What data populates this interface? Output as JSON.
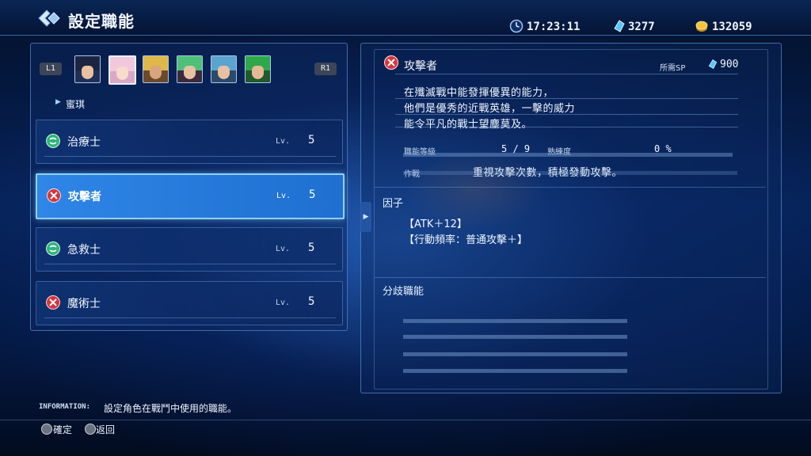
{
  "header": {
    "title": "設定職能",
    "time": "17:23:11",
    "crystals": "3277",
    "gold": "132059"
  },
  "left": {
    "l1": "L1",
    "r1": "R1",
    "portraits": [
      "character-portrait-1",
      "character-portrait-2",
      "character-portrait-3",
      "character-portrait-4",
      "character-portrait-5",
      "character-portrait-6"
    ],
    "character_name": "蜜琪",
    "jobs": [
      {
        "name": "治療士",
        "lv_label": "Lv.",
        "lv": "5",
        "icon": "heal-icon"
      },
      {
        "name": "攻擊者",
        "lv_label": "Lv.",
        "lv": "5",
        "icon": "attack-icon"
      },
      {
        "name": "急救士",
        "lv_label": "Lv.",
        "lv": "5",
        "icon": "heal-icon"
      },
      {
        "name": "魔術士",
        "lv_label": "Lv.",
        "lv": "5",
        "icon": "attack-icon"
      }
    ]
  },
  "detail": {
    "job_title": "攻擊者",
    "sp_label": "所需SP",
    "sp_value": "900",
    "description": [
      "在殲滅戰中能發揮優異的能力，",
      "他們是優秀的近戰英雄，一擊的威力",
      "能令平凡的戰士望塵莫及。"
    ],
    "job_level_label": "職能等級",
    "job_level": "5 / 9",
    "proficiency_label": "熟練度",
    "proficiency": "0 %",
    "tactic_label": "作戰",
    "tactic": "重視攻擊次數，積極發動攻擊。",
    "factors_title": "因子",
    "factors": [
      "【ATK＋12】",
      "【行動頻率：普通攻擊＋】"
    ],
    "branch_title": "分歧職能"
  },
  "footer": {
    "info_tag": "INFORMATION:",
    "info_text": "設定角色在戰鬥中使用的職能。",
    "confirm": "確定",
    "back": "返回"
  },
  "colors": {
    "accent": "#2f86e6",
    "heal_icon": "#2fb57a",
    "attack_icon": "#d8343c"
  }
}
